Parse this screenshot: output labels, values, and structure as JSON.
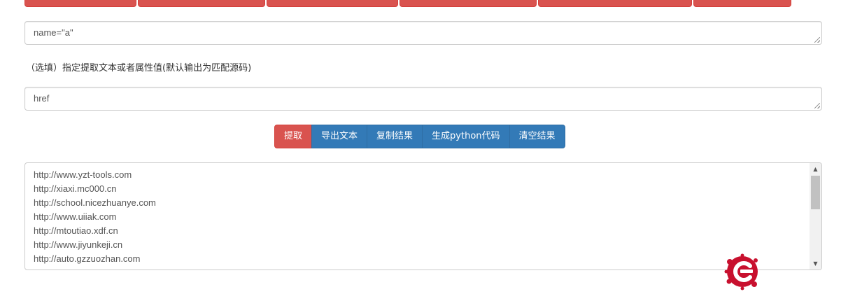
{
  "name_field": {
    "value": "name=\"a\""
  },
  "attr_hint": "（选填）指定提取文本或者属性值(默认输出为匹配源码)",
  "attr_field": {
    "value": "href"
  },
  "buttons": {
    "extract": "提取",
    "export_text": "导出文本",
    "copy_result": "复制结果",
    "gen_python": "生成python代码",
    "clear_result": "清空结果"
  },
  "result_lines": [
    "http://www.yzt-tools.com",
    "http://xiaxi.mc000.cn",
    "http://school.nicezhuanye.com",
    "http://www.uiiak.com",
    "http://mtoutiao.xdf.cn",
    "http://www.jiyunkeji.cn",
    "http://auto.gzzuozhan.com"
  ],
  "colors": {
    "danger": "#d9534f",
    "primary": "#337ab7",
    "border": "#cccccc"
  },
  "icons": {
    "logo": "red-c-splat-logo-icon"
  }
}
